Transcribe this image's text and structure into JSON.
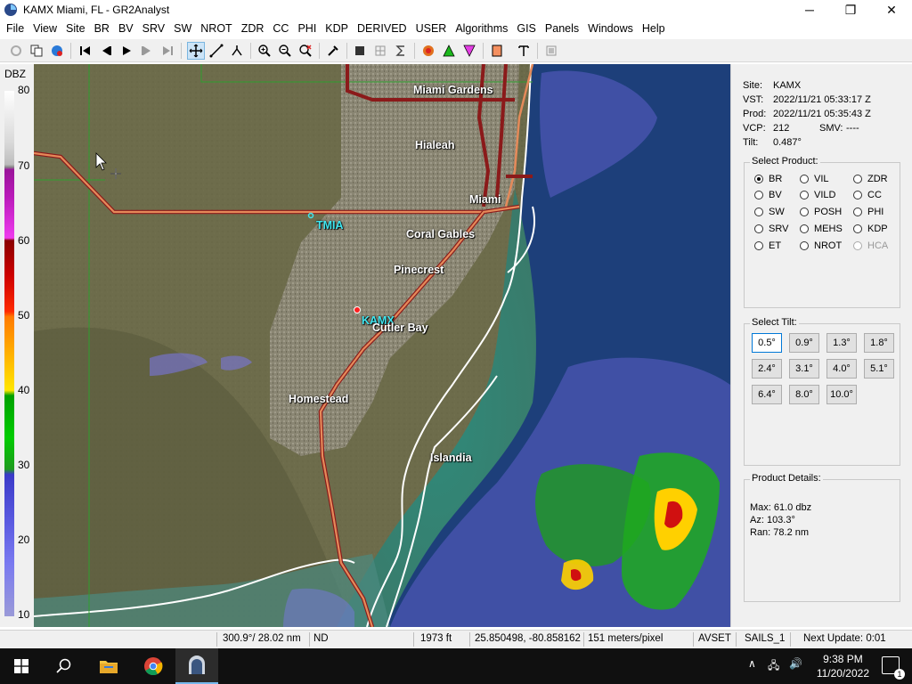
{
  "window": {
    "title": "KAMX Miami, FL - GR2Analyst",
    "controls": [
      "─",
      "❐",
      "✕"
    ]
  },
  "menu": [
    "File",
    "View",
    "Site",
    "BR",
    "BV",
    "SRV",
    "SW",
    "NROT",
    "ZDR",
    "CC",
    "PHI",
    "KDP",
    "DERIVED",
    "USER",
    "Algorithms",
    "GIS",
    "Panels",
    "Windows",
    "Help"
  ],
  "colorbar": {
    "title": "DBZ",
    "ticks": [
      "80",
      "70",
      "60",
      "50",
      "40",
      "30",
      "20",
      "10"
    ]
  },
  "map": {
    "labels": [
      "Miami Gardens",
      "Hialeah",
      "Miami",
      "TMIA",
      "Coral Gables",
      "Pinecrest",
      "KAMX",
      "Cutler Bay",
      "Homestead",
      "Islandia"
    ]
  },
  "site_info": {
    "site_label": "Site:",
    "site": "KAMX",
    "vst_label": "VST:",
    "vst": "2022/11/21  05:33:17 Z",
    "prod_label": "Prod:",
    "prod": "2022/11/21  05:35:43 Z",
    "vcp_label": "VCP:",
    "vcp": "212",
    "smv_label": "SMV:",
    "smv": "----",
    "tilt_label": "Tilt:",
    "tilt": "0.487°"
  },
  "select_product": {
    "title": "Select Product:",
    "options": [
      "BR",
      "VIL",
      "ZDR",
      "BV",
      "VILD",
      "CC",
      "SW",
      "POSH",
      "PHI",
      "SRV",
      "MEHS",
      "KDP",
      "ET",
      "NROT",
      "HCA"
    ],
    "selected": "BR"
  },
  "select_tilt": {
    "title": "Select Tilt:",
    "tilts": [
      "0.5°",
      "0.9°",
      "1.3°",
      "1.8°",
      "2.4°",
      "3.1°",
      "4.0°",
      "5.1°",
      "6.4°",
      "8.0°",
      "10.0°"
    ],
    "selected": "0.5°"
  },
  "product_details": {
    "title": "Product Details:",
    "max": "Max:  61.0 dbz",
    "az": "Az:  103.3°",
    "ran": "Ran:  78.2 nm"
  },
  "status": {
    "azran": "300.9°/ 28.02 nm",
    "value": "ND",
    "height": "1973 ft",
    "latlon": "25.850498, -80.858162",
    "resolution": "151 meters/pixel",
    "avset": "AVSET",
    "sails": "SAILS_1",
    "next_update": "Next Update: 0:01"
  },
  "taskbar": {
    "time": "9:38 PM",
    "date": "11/20/2022",
    "notifications": "1"
  },
  "colors": {
    "land": "#6a6a4a",
    "ocean": "#1d3f7a",
    "road": "#e58a5a",
    "highway": "#8b1a1a",
    "coast": "#ffffff",
    "accent": "#0078d7"
  }
}
